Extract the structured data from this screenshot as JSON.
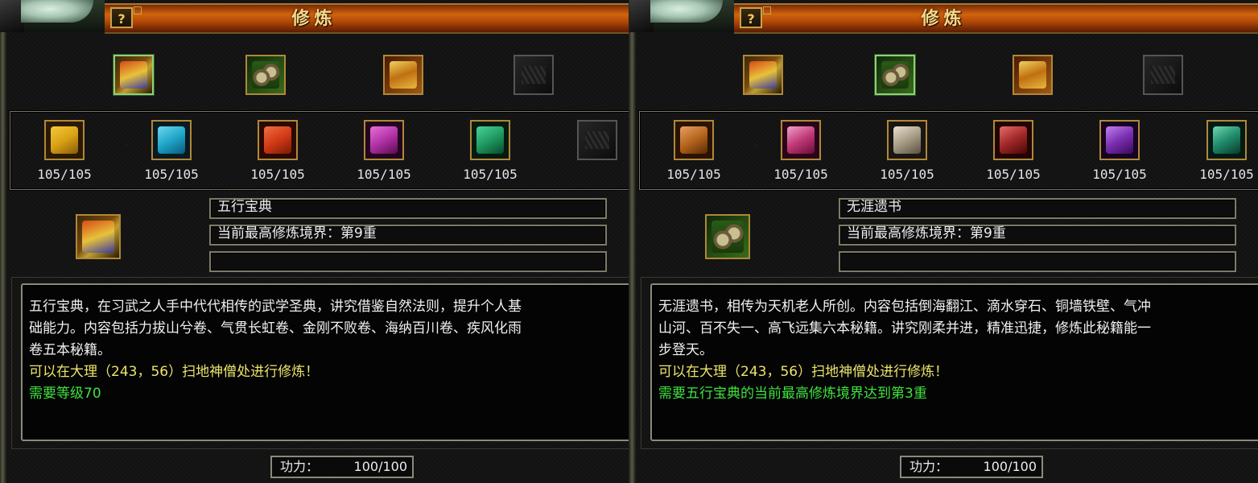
{
  "panels": [
    {
      "title": "修炼",
      "help_label": "?",
      "top_icons": [
        {
          "icon": "golden-book-icon",
          "selected": true
        },
        {
          "icon": "scroll-bundle-icon",
          "selected": false
        },
        {
          "icon": "treasure-scrolls-icon",
          "selected": false
        },
        {
          "icon": "empty-slot-icon",
          "selected": false
        }
      ],
      "books": [
        {
          "icon": "yellow-manual-icon",
          "color": "#d9a216",
          "count": "105/105"
        },
        {
          "icon": "cyan-manual-icon",
          "color": "#1fa6c9",
          "count": "105/105"
        },
        {
          "icon": "red-manual-icon",
          "color": "#d23a16",
          "count": "105/105"
        },
        {
          "icon": "magenta-manual-icon",
          "color": "#b232a8",
          "count": "105/105"
        },
        {
          "icon": "teal-manual-icon",
          "color": "#1f9b62",
          "count": "105/105"
        },
        {
          "icon": "empty-slot-icon",
          "color": "",
          "count": ""
        }
      ],
      "selected_icon": "golden-book-icon",
      "name": "五行宝典",
      "realm": "当前最高修炼境界：第9重",
      "extra": "",
      "desc_lines": [
        "五行宝典，在习武之人手中代代相传的武学圣典，讲究借鉴自然法则，提升个人基",
        "础能力。内容包括力拔山兮卷、气贯长虹卷、金刚不败卷、海纳百川卷、疾风化雨",
        "卷五本秘籍。"
      ],
      "location_line": "可以在大理（243，56）扫地神僧处进行修炼！",
      "requirement_line": "需要等级70",
      "power_label": "功力：",
      "power_value": "100/100"
    },
    {
      "title": "修炼",
      "help_label": "?",
      "top_icons": [
        {
          "icon": "golden-book-icon",
          "selected": false
        },
        {
          "icon": "scroll-bundle-icon",
          "selected": true
        },
        {
          "icon": "treasure-scrolls-icon",
          "selected": false
        },
        {
          "icon": "empty-slot-icon",
          "selected": false
        }
      ],
      "books": [
        {
          "icon": "orange-scroll-icon",
          "color": "#b5651d",
          "count": "105/105"
        },
        {
          "icon": "pink-scroll-icon",
          "color": "#c03a78",
          "count": "105/105"
        },
        {
          "icon": "white-scroll-icon",
          "color": "#a89c86",
          "count": "105/105"
        },
        {
          "icon": "crimson-scroll-icon",
          "color": "#a02828",
          "count": "105/105"
        },
        {
          "icon": "violet-scroll-icon",
          "color": "#7a2eb0",
          "count": "105/105"
        },
        {
          "icon": "jade-scroll-icon",
          "color": "#1f8a6a",
          "count": "105/105"
        }
      ],
      "selected_icon": "scroll-bundle-icon",
      "name": "无涯遗书",
      "realm": "当前最高修炼境界：第9重",
      "extra": "",
      "desc_lines": [
        "无涯遗书，相传为天机老人所创。内容包括倒海翻江、滴水穿石、铜墙铁壁、气冲",
        "山河、百不失一、高飞远集六本秘籍。讲究刚柔并进，精准迅捷，修炼此秘籍能一",
        "步登天。"
      ],
      "location_line": "可以在大理（243，56）扫地神僧处进行修炼！",
      "requirement_line": "需要五行宝典的当前最高修炼境界达到第3重",
      "power_label": "功力：",
      "power_value": "100/100"
    }
  ]
}
